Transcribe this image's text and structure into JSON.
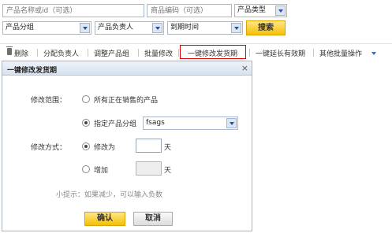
{
  "search": {
    "product_name_placeholder": "产品名称或id（可选）",
    "product_code_placeholder": "商品编码（可选）",
    "product_type": "产品类型",
    "product_group": "产品分组",
    "product_owner": "产品负责人",
    "expire_time": "到期时间",
    "search_label": "搜索"
  },
  "toolbar": {
    "items": [
      "删除",
      "分配负责人",
      "调整产品组",
      "批量修改",
      "一键修改发货期",
      "一键延长有效期",
      "其他批量操作"
    ]
  },
  "dialog": {
    "title": "一键修改发货期",
    "close": "×",
    "scope_label": "修改范围：",
    "scope_all": "所有正在销售的产品",
    "scope_group": "指定产品分组",
    "group_value": "fsags",
    "method_label": "修改方式：",
    "method_set": "修改为",
    "method_add": "增加",
    "day_unit": "天",
    "hint": "小提示：如果减少，可以输入负数",
    "ok_label": "确认",
    "cancel_label": "取消"
  }
}
